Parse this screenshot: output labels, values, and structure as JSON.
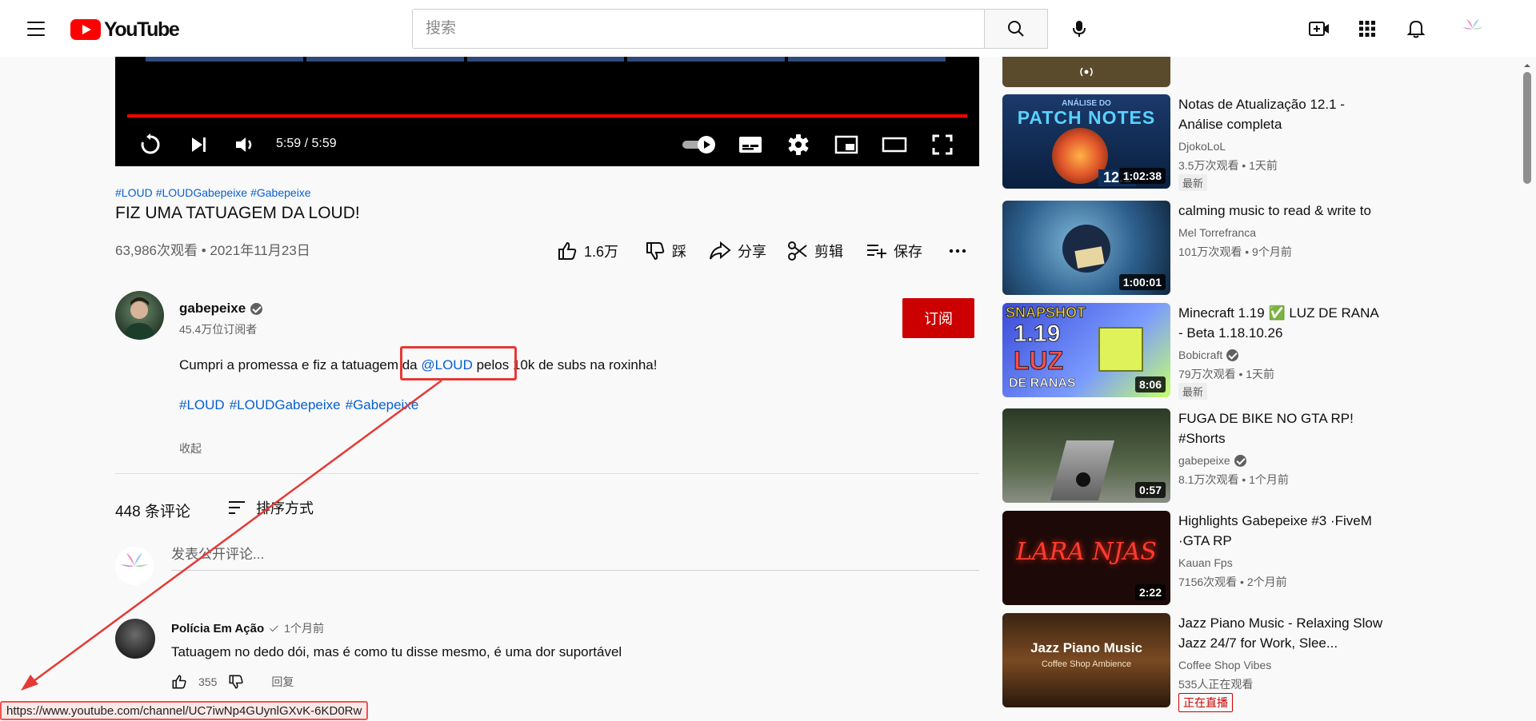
{
  "header": {
    "logo_text": "YouTube",
    "search_placeholder": "搜索"
  },
  "player": {
    "time": "5:59 / 5:59"
  },
  "video": {
    "hashtags": [
      "#LOUD",
      "#LOUDGabepeixe",
      "#Gabepeixe"
    ],
    "title": "FIZ UMA TATUAGEM DA LOUD!",
    "meta": "63,986次观看 • 2021年11月23日",
    "actions": {
      "like": "1.6万",
      "dislike": "踩",
      "share": "分享",
      "clip": "剪辑",
      "save": "保存"
    }
  },
  "channel": {
    "name": "gabepeixe",
    "subscribers": "45.4万位订阅者",
    "subscribe_label": "订阅"
  },
  "description": {
    "text_before": "Cumpri a promessa e fiz a tatuagem da ",
    "mention": "@LOUD",
    "text_after": " pelos 10k de subs na roxinha!",
    "hashtags": [
      "#LOUD",
      "#LOUDGabepeixe",
      "#Gabepeixe"
    ],
    "collapse_label": "收起"
  },
  "comments": {
    "count": "448 条评论",
    "sort_label": "排序方式",
    "input_placeholder": "发表公开评论...",
    "items": [
      {
        "author": "Polícia Em Ação",
        "when": "1个月前",
        "text": "Tatuagem no dedo dói, mas é como tu disse mesmo, é uma dor suportável",
        "likes": "355",
        "reply_label": "回复"
      }
    ]
  },
  "status_url": "https://www.youtube.com/channel/UC7iwNp4GUynlGXvK-6KD0Rw",
  "sidebar": {
    "items": [
      {
        "title": "Notas de Atualização 12.1 - Análise completa",
        "channel": "DjokoLoL",
        "meta": "3.5万次观看 • 1天前",
        "badge": "最新",
        "duration": "1:02:38",
        "thumb_text": "PATCH NOTES",
        "thumb_sub": "ANÁLISE DO",
        "thumb_num": "12.1"
      },
      {
        "title": "calming music to read & write to",
        "channel": "Mel Torrefranca",
        "meta": "101万次观看 • 9个月前",
        "duration": "1:00:01"
      },
      {
        "title": "Minecraft 1.19 ✅ LUZ DE RANA - Beta 1.18.10.26",
        "channel": "Bobicraft",
        "meta": "79万次观看 • 1天前",
        "badge": "最新",
        "duration": "8:06",
        "thumb_text": "SNAPSHOT",
        "thumb_num": "1.19",
        "thumb_sub": "LUZ",
        "thumb_sub2": "DE RANAS"
      },
      {
        "title": "FUGA DE BIKE NO GTA RP! #Shorts",
        "channel": "gabepeixe",
        "meta": "8.1万次观看 • 1个月前",
        "duration": "0:57"
      },
      {
        "title": "Highlights Gabepeixe #3 ·FiveM ·GTA RP",
        "channel": "Kauan Fps",
        "meta": "7156次观看 • 2个月前",
        "duration": "2:22",
        "thumb_text": "LARA NJAS"
      },
      {
        "title": "Jazz Piano Music - Relaxing Slow Jazz 24/7 for Work, Slee...",
        "channel": "Coffee Shop Vibes",
        "meta": "535人正在观看",
        "live_label": "正在直播",
        "thumb_text": "Jazz Piano Music",
        "thumb_sub": "Coffee Shop Ambience"
      }
    ]
  }
}
